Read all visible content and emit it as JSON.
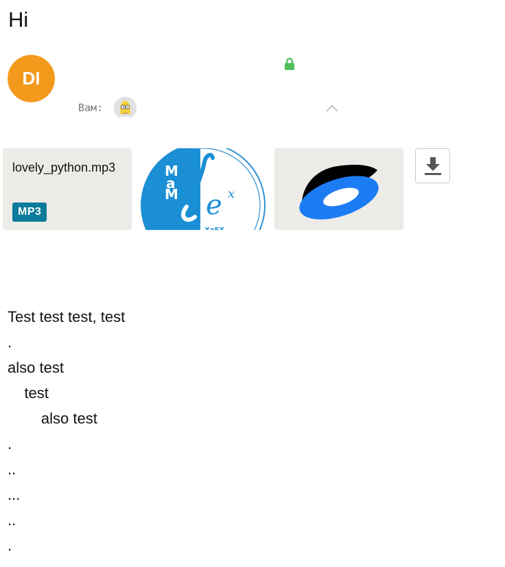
{
  "message": {
    "subject": "Hi",
    "sender": {
      "initials": "DI",
      "avatar_color": "#f39a1c"
    },
    "encrypted_icon": "lock-icon",
    "recipients": {
      "label": "Вам:"
    },
    "collapse_icon": "chevron-up-icon"
  },
  "attachments": [
    {
      "type": "file",
      "name": "lovely_python.mp3",
      "badge": "MP3",
      "badge_color": "#0d7b9b"
    },
    {
      "type": "image",
      "description_icon": "mathmech-logo-thumbnail"
    },
    {
      "type": "cloud",
      "description_icon": "yandex-disk-icon"
    }
  ],
  "download_all": {
    "icon": "download-icon"
  },
  "body_lines": [
    "Test test test, test",
    ".",
    "also test",
    "    test",
    "        also test",
    ".",
    "..",
    "...",
    "..",
    "."
  ],
  "colors": {
    "lock": "#4fbf5a",
    "chevron": "#b8b8b8",
    "tile_bg": "#edebe8"
  }
}
